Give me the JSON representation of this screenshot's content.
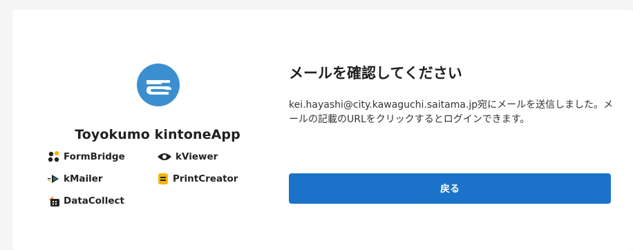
{
  "brand": {
    "title": "Toyokumo kintoneApp",
    "logo_icon": "toyokumo-logo-icon",
    "logo_color": "#3b8fd1",
    "products": [
      {
        "label": "FormBridge",
        "icon": "formbridge-icon"
      },
      {
        "label": "kViewer",
        "icon": "kviewer-eye-icon"
      },
      {
        "label": "kMailer",
        "icon": "kmailer-icon"
      },
      {
        "label": "PrintCreator",
        "icon": "printcreator-icon"
      },
      {
        "label": "DataCollect",
        "icon": "datacollect-icon"
      }
    ]
  },
  "main": {
    "heading": "メールを確認してください",
    "message": "kei.hayashi@city.kawaguchi.saitama.jp宛にメールを送信しました。メールの記載のURLをクリックするとログインできます。",
    "back_label": "戻る"
  },
  "colors": {
    "accent": "#1a73c8",
    "background": "#f5f5f5",
    "card": "#ffffff",
    "printcreator": "#f2b705",
    "datacollect": "#f28c28",
    "kmailer": "#1b8c6e"
  }
}
